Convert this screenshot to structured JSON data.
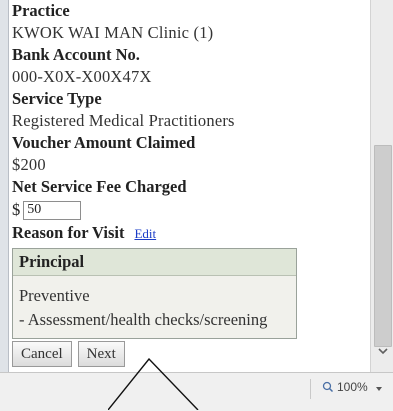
{
  "details": {
    "practice_label": "Practice",
    "practice_value": "KWOK WAI MAN Clinic (1)",
    "bank_label": "Bank Account No.",
    "bank_value": "000-X0X-X00X47X",
    "service_label": "Service Type",
    "service_value": "Registered Medical Practitioners",
    "voucher_label": "Voucher Amount Claimed",
    "voucher_value": "$200",
    "fee_label": "Net Service Fee Charged",
    "fee_currency": "$",
    "fee_value": "50",
    "reason_label": "Reason for Visit",
    "edit_link": "Edit"
  },
  "reason_box": {
    "header": "Principal",
    "line1": "Preventive",
    "line2": "- Assessment/health checks/screening"
  },
  "buttons": {
    "cancel": "Cancel",
    "next": "Next"
  },
  "statusbar": {
    "zoom": "100%"
  }
}
